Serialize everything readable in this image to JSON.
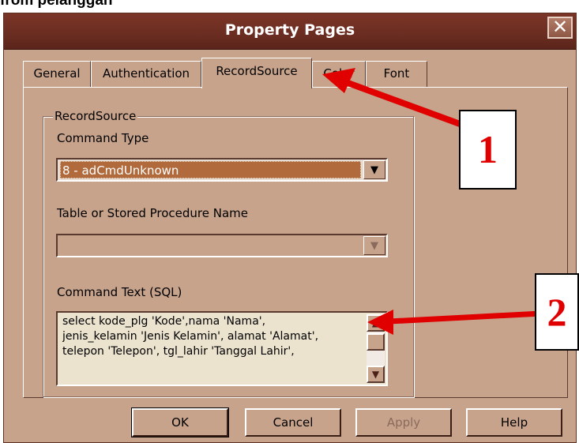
{
  "caption": "from pelanggan",
  "window": {
    "title": "Property Pages",
    "close_glyph": "✕"
  },
  "tabs": [
    {
      "label": "General",
      "active": false
    },
    {
      "label": "Authentication",
      "active": false
    },
    {
      "label": "RecordSource",
      "active": true
    },
    {
      "label": "Color",
      "active": false
    },
    {
      "label": "Font",
      "active": false
    }
  ],
  "recordsource": {
    "group_label": "RecordSource",
    "command_type_label": "Command Type",
    "command_type_value": "8 - adCmdUnknown",
    "table_label": "Table or Stored Procedure Name",
    "table_value": "",
    "command_text_label": "Command Text (SQL)",
    "command_text_value": "select kode_plg 'Kode',nama 'Nama',\njenis_kelamin 'Jenis Kelamin', alamat 'Alamat',\ntelepon 'Telepon', tgl_lahir 'Tanggal Lahir',"
  },
  "buttons": {
    "ok": "OK",
    "cancel": "Cancel",
    "apply": "Apply",
    "help": "Help"
  },
  "annotations": {
    "callout_1": "1",
    "callout_2": "2",
    "arrow_color": "#e00000"
  },
  "icons": {
    "dropdown": "▼",
    "scroll_up": "▲",
    "scroll_down": "▼"
  }
}
